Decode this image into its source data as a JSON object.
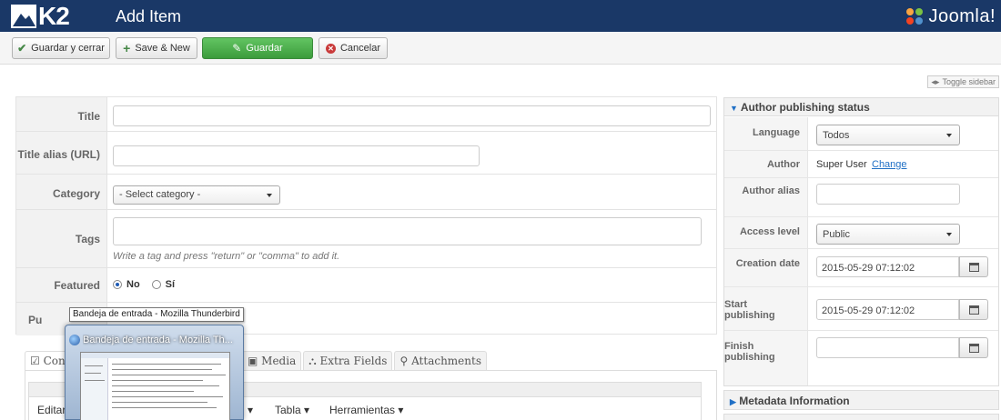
{
  "header": {
    "logo_text": "K2",
    "title": "Add Item",
    "joomla_text": "Joomla!"
  },
  "toolbar": {
    "save_close": "Guardar y cerrar",
    "save_new": "Save & New",
    "save": "Guardar",
    "cancel": "Cancelar"
  },
  "toggle_sidebar": "Toggle sidebar",
  "form": {
    "title_label": "Title",
    "title_value": "",
    "alias_label": "Title alias (URL)",
    "alias_value": "",
    "category_label": "Category",
    "category_selected": "- Select category -",
    "tags_label": "Tags",
    "tags_hint": "Write a tag and press \"return\" or \"comma\" to add it.",
    "featured_label": "Featured",
    "featured_no": "No",
    "featured_yes": "Sí",
    "featured_value": "No",
    "published_label_partial": "Pu"
  },
  "tabs": [
    {
      "label": "Cont",
      "icon": "edit-icon",
      "active": true
    },
    {
      "label": "Media",
      "icon": "image-icon"
    },
    {
      "label": "Extra Fields",
      "icon": "sitemap-icon"
    },
    {
      "label": "Attachments",
      "icon": "paperclip-icon"
    }
  ],
  "editor": {
    "menu": [
      "Editar",
      "Tabla",
      "Herramientas"
    ]
  },
  "sidebar": {
    "section_title": "Author publishing status",
    "language_label": "Language",
    "language_value": "Todos",
    "author_label": "Author",
    "author_value": "Super User",
    "author_change": "Change",
    "author_alias_label": "Author alias",
    "author_alias_value": "",
    "access_label": "Access level",
    "access_value": "Public",
    "creation_label": "Creation date",
    "creation_value": "2015-05-29 07:12:02",
    "start_label": "Start publishing",
    "start_value": "2015-05-29 07:12:02",
    "finish_label": "Finish publishing",
    "finish_value": "",
    "metadata_title": "Metadata Information"
  },
  "taskbar_preview": {
    "tooltip": "Bandeja de entrada - Mozilla Thunderbird",
    "window_title": "Bandeja de entrada - Mozilla Th..."
  },
  "colors": {
    "header_bg": "#1a3867",
    "save_green": "#46a546",
    "cancel_red": "#c93a3a",
    "link_blue": "#1f6fc5"
  }
}
